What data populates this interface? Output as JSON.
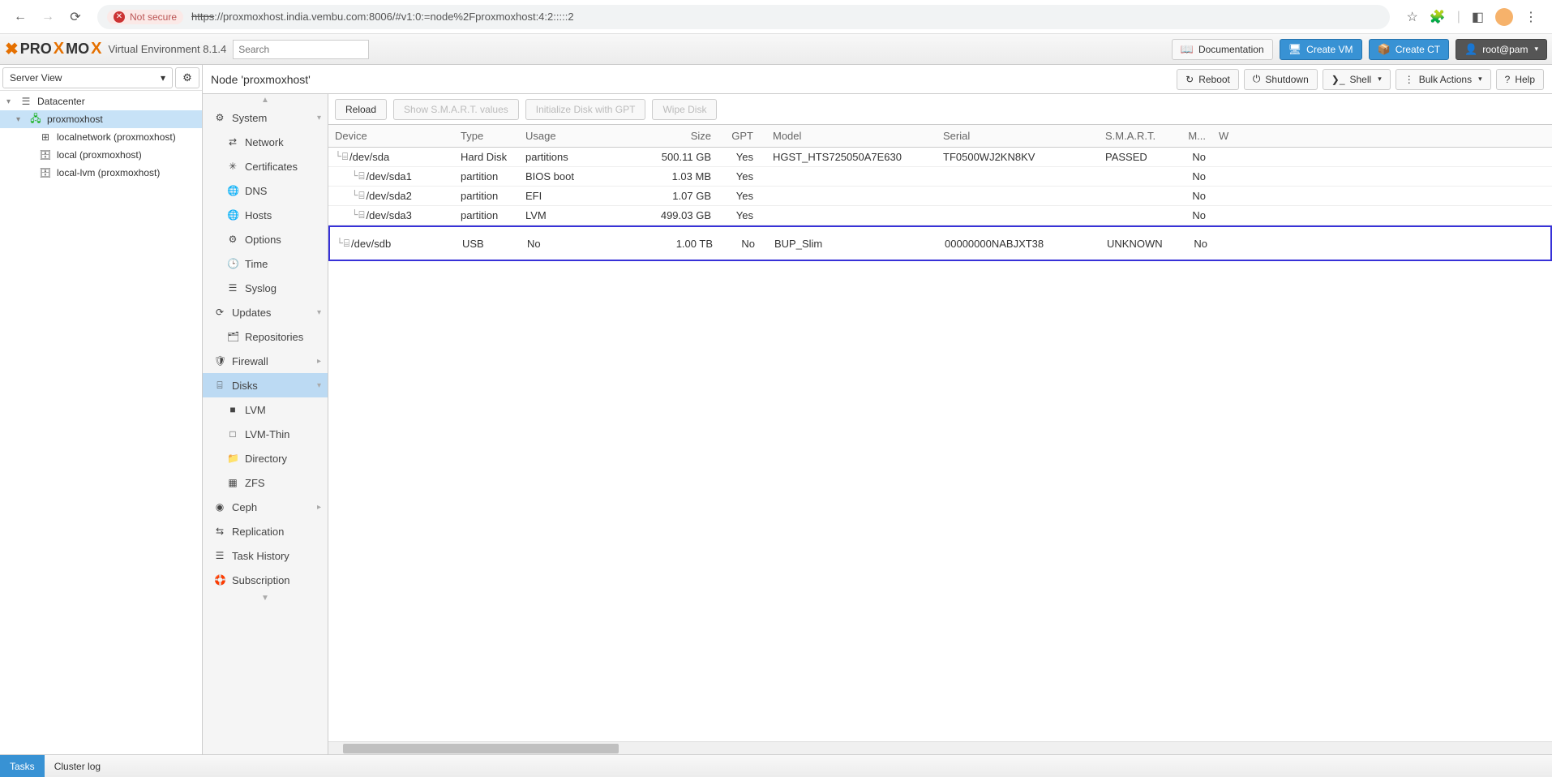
{
  "browser": {
    "not_secure": "Not secure",
    "url_scheme": "https",
    "url_host_path": "://proxmoxhost.india.vembu.com:8006/#v1:0:=node%2Fproxmoxhost:4:2:::::2"
  },
  "header": {
    "ve_label": "Virtual Environment 8.1.4",
    "search_placeholder": "Search",
    "documentation": "Documentation",
    "create_vm": "Create VM",
    "create_ct": "Create CT",
    "user": "root@pam"
  },
  "serverview": {
    "label": "Server View",
    "datacenter": "Datacenter",
    "node": "proxmoxhost",
    "children": [
      "localnetwork (proxmoxhost)",
      "local (proxmoxhost)",
      "local-lvm (proxmoxhost)"
    ]
  },
  "node_title": "Node 'proxmoxhost'",
  "node_buttons": {
    "reboot": "Reboot",
    "shutdown": "Shutdown",
    "shell": "Shell",
    "bulk": "Bulk Actions",
    "help": "Help"
  },
  "sidemenu": {
    "system": "System",
    "network": "Network",
    "certs": "Certificates",
    "dns": "DNS",
    "hosts": "Hosts",
    "options": "Options",
    "time": "Time",
    "syslog": "Syslog",
    "updates": "Updates",
    "repos": "Repositories",
    "firewall": "Firewall",
    "disks": "Disks",
    "lvm": "LVM",
    "lvmthin": "LVM-Thin",
    "directory": "Directory",
    "zfs": "ZFS",
    "ceph": "Ceph",
    "replication": "Replication",
    "taskhist": "Task History",
    "subscription": "Subscription"
  },
  "toolbar": {
    "reload": "Reload",
    "smart": "Show S.M.A.R.T. values",
    "init": "Initialize Disk with GPT",
    "wipe": "Wipe Disk"
  },
  "columns": {
    "device": "Device",
    "type": "Type",
    "usage": "Usage",
    "size": "Size",
    "gpt": "GPT",
    "model": "Model",
    "serial": "Serial",
    "smart": "S.M.A.R.T.",
    "m": "M...",
    "w": "W"
  },
  "rows": [
    {
      "indent": 0,
      "dev": "/dev/sda",
      "type": "Hard Disk",
      "usage": "partitions",
      "size": "500.11 GB",
      "gpt": "Yes",
      "model": "HGST_HTS725050A7E630",
      "serial": "TF0500WJ2KN8KV",
      "smart": "PASSED",
      "m": "No",
      "hl": false
    },
    {
      "indent": 1,
      "dev": "/dev/sda1",
      "type": "partition",
      "usage": "BIOS boot",
      "size": "1.03 MB",
      "gpt": "Yes",
      "model": "",
      "serial": "",
      "smart": "",
      "m": "No",
      "hl": false
    },
    {
      "indent": 1,
      "dev": "/dev/sda2",
      "type": "partition",
      "usage": "EFI",
      "size": "1.07 GB",
      "gpt": "Yes",
      "model": "",
      "serial": "",
      "smart": "",
      "m": "No",
      "hl": false
    },
    {
      "indent": 1,
      "dev": "/dev/sda3",
      "type": "partition",
      "usage": "LVM",
      "size": "499.03 GB",
      "gpt": "Yes",
      "model": "",
      "serial": "",
      "smart": "",
      "m": "No",
      "hl": false
    },
    {
      "indent": 0,
      "dev": "/dev/sdb",
      "type": "USB",
      "usage": "No",
      "size": "1.00 TB",
      "gpt": "No",
      "model": "BUP_Slim",
      "serial": "00000000NABJXT38",
      "smart": "UNKNOWN",
      "m": "No",
      "hl": true
    }
  ],
  "footer": {
    "tasks": "Tasks",
    "cluster": "Cluster log"
  }
}
